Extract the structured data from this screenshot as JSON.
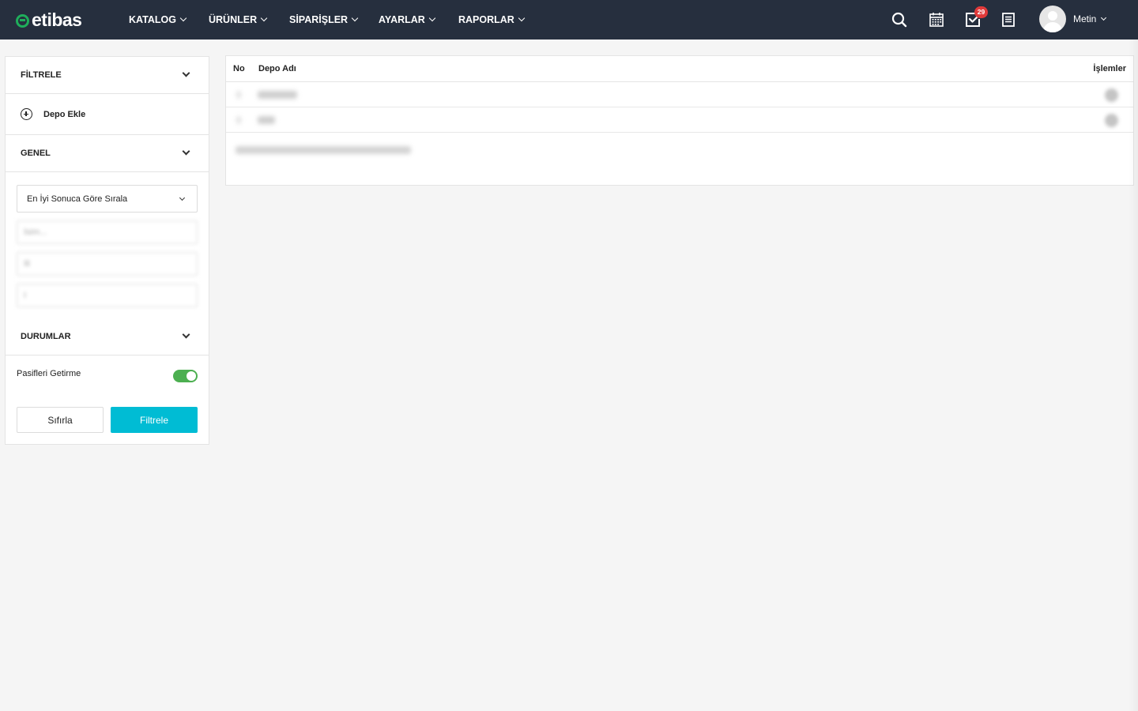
{
  "brand": {
    "name": "etibas",
    "accent": "#1fae5b"
  },
  "nav": {
    "items": [
      {
        "label": "KATALOG"
      },
      {
        "label": "ÜRÜNLER"
      },
      {
        "label": "SİPARİŞLER"
      },
      {
        "label": "AYARLAR"
      },
      {
        "label": "RAPORLAR"
      }
    ],
    "icons": [
      "search-icon",
      "calendar-icon",
      "tasks-icon",
      "document-icon"
    ],
    "task_count": "29",
    "user": "Metin"
  },
  "sidebar": {
    "filter_title": "FİLTRELE",
    "add_label": "Depo Ekle",
    "general_title": "GENEL",
    "sort_value": "En İyi Sonuca Göre Sırala",
    "name_placeholder": "İsim...",
    "field2_placeholder": "Ili",
    "field3_placeholder": "I",
    "status_title": "DURUMLAR",
    "toggle_label": "Pasifleri Getirme",
    "toggle_on": true,
    "reset_label": "Sıfırla",
    "filter_label": "Filtrele",
    "filter_color": "#00bcd4"
  },
  "table": {
    "col_no": "No",
    "col_name": "Depo Adı",
    "col_actions": "İşlemler"
  }
}
